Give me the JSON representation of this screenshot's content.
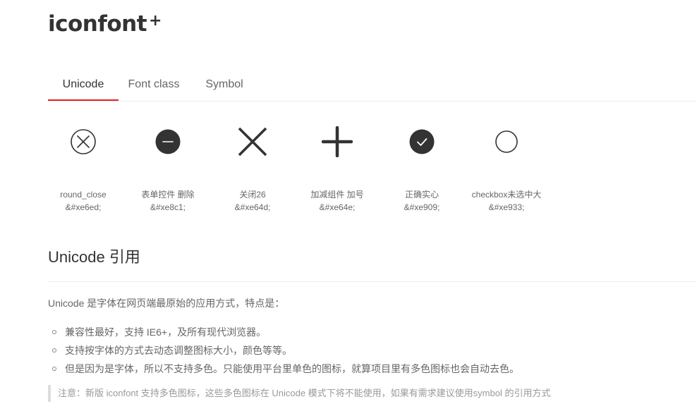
{
  "logo": {
    "text": "iconfont",
    "superscript": "+"
  },
  "tabs": [
    {
      "label": "Unicode",
      "active": true
    },
    {
      "label": "Font class",
      "active": false
    },
    {
      "label": "Symbol",
      "active": false
    }
  ],
  "accent_color": "#e2231a",
  "icons": [
    {
      "name": "round_close",
      "code": "&#xe6ed;",
      "glyph": "round-close-icon"
    },
    {
      "name": "表单控件 删除",
      "code": "&#xe8c1;",
      "glyph": "minus-circle-filled-icon"
    },
    {
      "name": "关闭26",
      "code": "&#xe64d;",
      "glyph": "close-icon"
    },
    {
      "name": "加减组件 加号",
      "code": "&#xe64e;",
      "glyph": "plus-icon"
    },
    {
      "name": "正确实心",
      "code": "&#xe909;",
      "glyph": "check-circle-filled-icon"
    },
    {
      "name": "checkbox未选中大",
      "code": "&#xe933;",
      "glyph": "circle-outline-icon"
    }
  ],
  "section": {
    "title": "Unicode 引用",
    "intro": "Unicode 是字体在网页端最原始的应用方式，特点是：",
    "bullets": [
      "兼容性最好，支持 IE6+，及所有现代浏览器。",
      "支持按字体的方式去动态调整图标大小，颜色等等。",
      "但是因为是字体，所以不支持多色。只能使用平台里单色的图标，就算项目里有多色图标也会自动去色。"
    ],
    "note": "注意：新版 iconfont 支持多色图标，这些多色图标在 Unicode 模式下将不能使用，如果有需求建议使用symbol 的引用方式"
  }
}
